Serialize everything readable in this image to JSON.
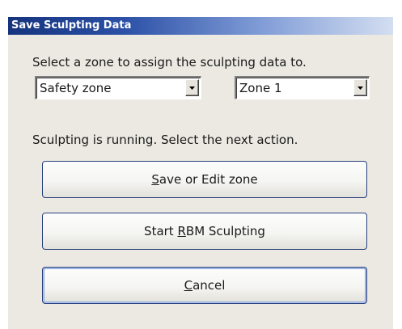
{
  "window": {
    "title": "Save Sculpting Data"
  },
  "zone_prompt": "Select a zone to assign the sculpting data to.",
  "zone_type_select": {
    "value": "Safety zone"
  },
  "zone_number_select": {
    "value": "Zone 1"
  },
  "status_text": "Sculpting is running. Select the next action.",
  "buttons": {
    "save_edit": {
      "mnemonic": "S",
      "rest": "ave or Edit zone"
    },
    "start_rbm": {
      "before": "Start ",
      "mnemonic": "R",
      "rest": "BM Sculpting"
    },
    "cancel": {
      "mnemonic": "C",
      "rest": "ancel"
    }
  },
  "colors": {
    "titlebar_start": "#16347e",
    "titlebar_end": "#d3def1",
    "dialog_background": "#ebe9e2",
    "button_border": "#27407c"
  },
  "icons": {
    "dropdown_arrow": "chevron-down-icon"
  }
}
